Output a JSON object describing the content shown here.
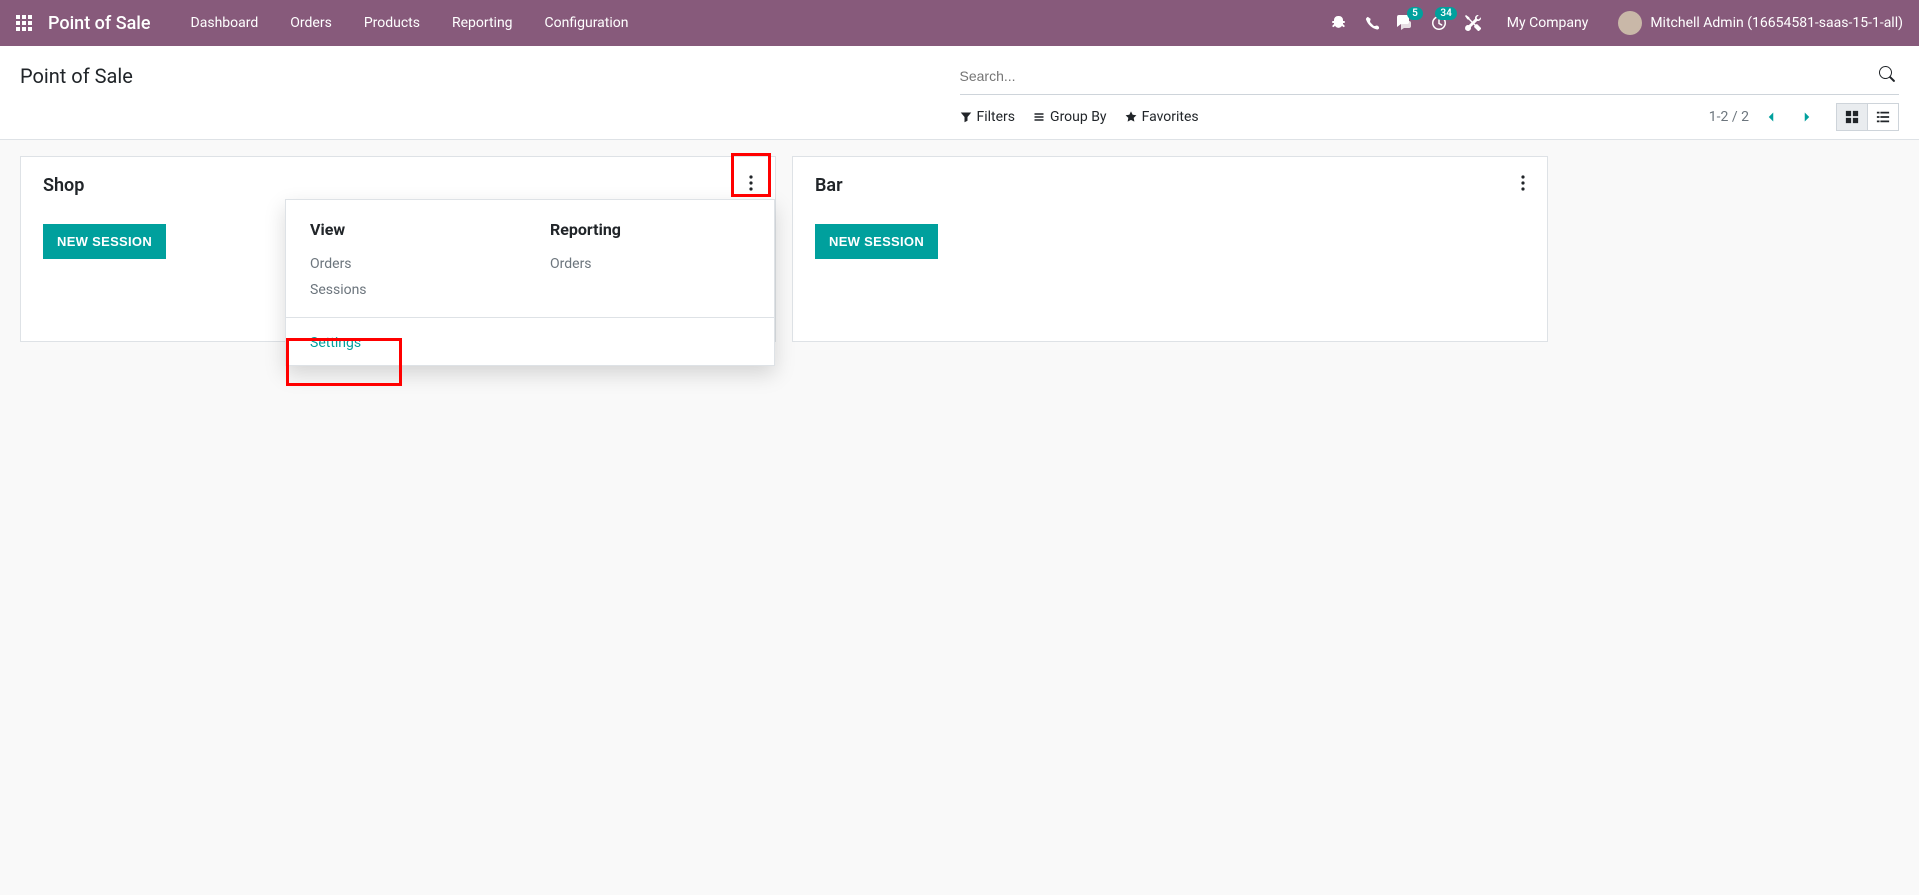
{
  "navbar": {
    "brand": "Point of Sale",
    "links": [
      "Dashboard",
      "Orders",
      "Products",
      "Reporting",
      "Configuration"
    ],
    "messaging_badge": "5",
    "activities_badge": "34",
    "company": "My Company",
    "user": "Mitchell Admin (16654581-saas-15-1-all)"
  },
  "control_panel": {
    "title": "Point of Sale",
    "search_placeholder": "Search...",
    "filters": "Filters",
    "group_by": "Group By",
    "favorites": "Favorites",
    "pager": "1-2 / 2"
  },
  "cards": [
    {
      "title": "Shop",
      "button": "NEW SESSION"
    },
    {
      "title": "Bar",
      "button": "NEW SESSION"
    }
  ],
  "popover": {
    "view_header": "View",
    "view_items": [
      "Orders",
      "Sessions"
    ],
    "reporting_header": "Reporting",
    "reporting_items": [
      "Orders"
    ],
    "settings": "Settings"
  }
}
